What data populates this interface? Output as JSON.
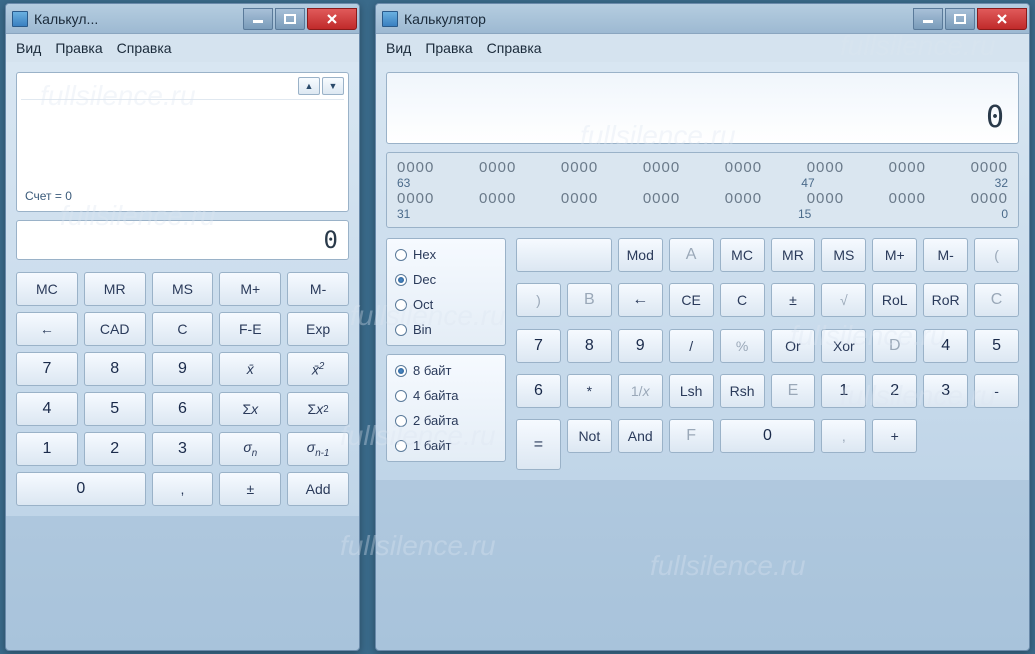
{
  "watermark": "fullsilence.ru",
  "left": {
    "title": "Калькул...",
    "menu": [
      "Вид",
      "Правка",
      "Справка"
    ],
    "stat_label": "Счет = 0",
    "display": "0",
    "rows": [
      [
        "MC",
        "MR",
        "MS",
        "M+",
        "M-"
      ],
      [
        "←",
        "CAD",
        "C",
        "F-E",
        "Exp"
      ],
      [
        "7",
        "8",
        "9",
        "x̄",
        "x̄²"
      ],
      [
        "4",
        "5",
        "6",
        "Σx",
        "Σx²"
      ],
      [
        "1",
        "2",
        "3",
        "σₙ",
        "σₙ₋₁"
      ]
    ],
    "last_row": [
      "0",
      ",",
      "±",
      "Add"
    ]
  },
  "right": {
    "title": "Калькулятор",
    "menu": [
      "Вид",
      "Правка",
      "Справка"
    ],
    "display": "0",
    "bits": {
      "row1": [
        "0000",
        "0000",
        "0000",
        "0000",
        "0000",
        "0000",
        "0000",
        "0000"
      ],
      "lab1": [
        "63",
        "47",
        "32"
      ],
      "row2": [
        "0000",
        "0000",
        "0000",
        "0000",
        "0000",
        "0000",
        "0000",
        "0000"
      ],
      "lab2": [
        "31",
        "15",
        "0"
      ]
    },
    "base": [
      {
        "label": "Hex",
        "on": false
      },
      {
        "label": "Dec",
        "on": true
      },
      {
        "label": "Oct",
        "on": false
      },
      {
        "label": "Bin",
        "on": false
      }
    ],
    "word": [
      {
        "label": "8 байт",
        "on": true
      },
      {
        "label": "4 байта",
        "on": false
      },
      {
        "label": "2 байта",
        "on": false
      },
      {
        "label": "1 байт",
        "on": false
      }
    ],
    "keys": {
      "r1": [
        "",
        "Mod",
        "A",
        "MC",
        "MR",
        "MS",
        "M+",
        "M-"
      ],
      "r2": [
        "(",
        ")",
        "B",
        "←",
        "CE",
        "C",
        "±",
        "√"
      ],
      "r3": [
        "RoL",
        "RoR",
        "C",
        "7",
        "8",
        "9",
        "/",
        "%"
      ],
      "r4": [
        "Or",
        "Xor",
        "D",
        "4",
        "5",
        "6",
        "*",
        "1/x"
      ],
      "r5": [
        "Lsh",
        "Rsh",
        "E",
        "1",
        "2",
        "3",
        "-",
        "="
      ],
      "r6": [
        "Not",
        "And",
        "F",
        "0",
        ",",
        "+"
      ]
    }
  }
}
